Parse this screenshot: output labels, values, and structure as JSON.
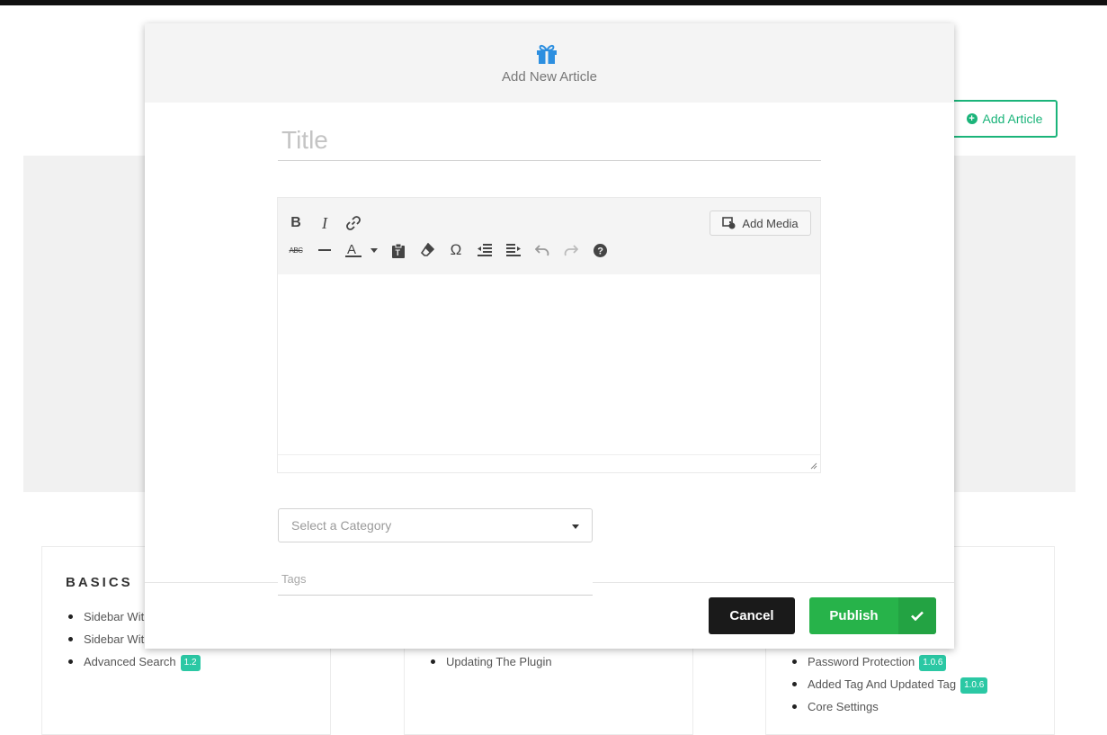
{
  "page": {
    "add_article_label": "Add Article",
    "columns": [
      {
        "title": "BASICS",
        "items": [
          {
            "label": "Sidebar Wit",
            "badge": ""
          },
          {
            "label": "Sidebar Wit",
            "badge": ""
          },
          {
            "label": "Advanced Search",
            "badge": "1.2"
          }
        ]
      },
      {
        "title": "",
        "items": [
          {
            "label": "Updating The Plugin",
            "badge": ""
          }
        ]
      },
      {
        "title": "",
        "items": [
          {
            "label": "Password Protection",
            "badge": "1.0.6"
          },
          {
            "label": "Added Tag And Updated Tag",
            "badge": "1.0.6"
          },
          {
            "label": "Core Settings",
            "badge": ""
          }
        ]
      }
    ]
  },
  "modal": {
    "header_icon": "gift-icon",
    "title": "Add New Article",
    "title_placeholder": "Title",
    "title_value": "",
    "editor": {
      "toolbar_row1": [
        "bold-icon",
        "italic-icon",
        "link-icon"
      ],
      "toolbar_row2": [
        "strikethrough-icon",
        "horizontal-rule-icon",
        "text-color-icon",
        "paste-text-icon",
        "clear-formatting-icon",
        "special-character-icon",
        "outdent-icon",
        "indent-icon",
        "undo-icon",
        "redo-icon",
        "help-icon"
      ],
      "add_media_label": "Add Media",
      "content": ""
    },
    "category_placeholder": "Select a Category",
    "tags_placeholder": "Tags",
    "cancel_label": "Cancel",
    "publish_label": "Publish"
  },
  "colors": {
    "accent_green": "#1bb47a",
    "publish_green": "#27b34a",
    "badge_teal": "#2bc8a4",
    "gift_blue": "#2d8fe0"
  }
}
